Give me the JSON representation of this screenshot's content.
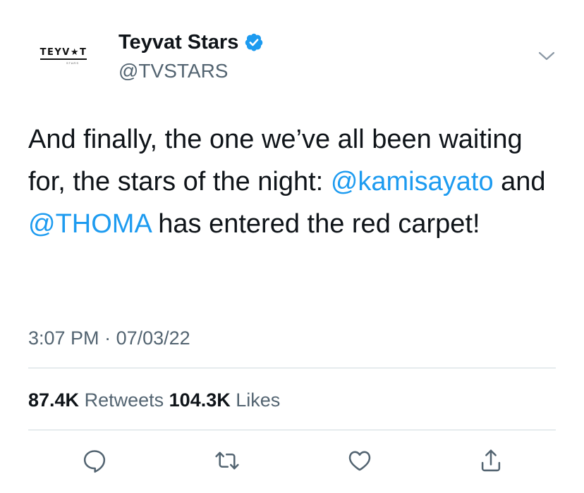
{
  "account": {
    "logo_text": "TEYV★T",
    "logo_sub": "STARS",
    "display_name": "Teyvat Stars",
    "handle": "@TVSTARS",
    "verified": true
  },
  "tweet": {
    "text_part1": "And finally, the one we’ve all been waiting for, the stars of the night: ",
    "mention1": "@kamisayato",
    "text_part2": " and ",
    "mention2": "@THOMA",
    "text_part3": " has entered the red carpet!",
    "time": "3:07 PM",
    "separator": " · ",
    "date": "07/03/22"
  },
  "stats": {
    "retweets_count": "87.4K",
    "retweets_label": "Retweets",
    "likes_count": "104.3K",
    "likes_label": "Likes"
  },
  "actions": [
    {
      "name": "reply",
      "icon": "comment-icon"
    },
    {
      "name": "retweet",
      "icon": "retweet-icon"
    },
    {
      "name": "like",
      "icon": "heart-icon"
    },
    {
      "name": "share",
      "icon": "share-icon"
    }
  ],
  "colors": {
    "text": "#0f1419",
    "secondary": "#536471",
    "link": "#1d9bf0",
    "divider": "#cfd9de"
  }
}
